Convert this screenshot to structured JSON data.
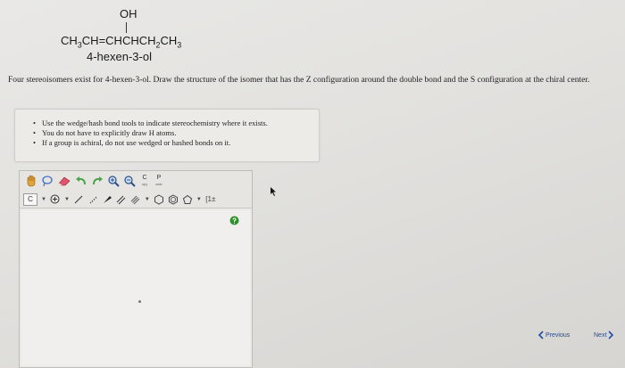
{
  "formula": {
    "hydroxyl": "OH",
    "chain_parts": [
      "CH",
      "3",
      "CH=CHCHCH",
      "2",
      "CH",
      "3"
    ]
  },
  "compound_name": "4-hexen-3-ol",
  "question": "Four stereoisomers exist for 4-hexen-3-ol. Draw the structure of the isomer that has the Z configuration around the double bond and the S configuration at the chiral center.",
  "instructions": [
    "Use the wedge/hash bond tools to indicate stereochemistry where it exists.",
    "You do not have to explicitly draw H atoms.",
    "If a group is achiral, do not use wedged or hashed bonds on it."
  ],
  "toolbar": {
    "copy_letter": "C",
    "copy_sub": "opy",
    "paste_letter": "P",
    "paste_sub": "aste",
    "element_label": "C",
    "bracket_label": "[1±"
  },
  "navigation": {
    "previous_label": "Previous",
    "next_label": "Next"
  },
  "colors": {
    "accent": "#1f4fa3",
    "help_green": "#2f8f2f"
  }
}
